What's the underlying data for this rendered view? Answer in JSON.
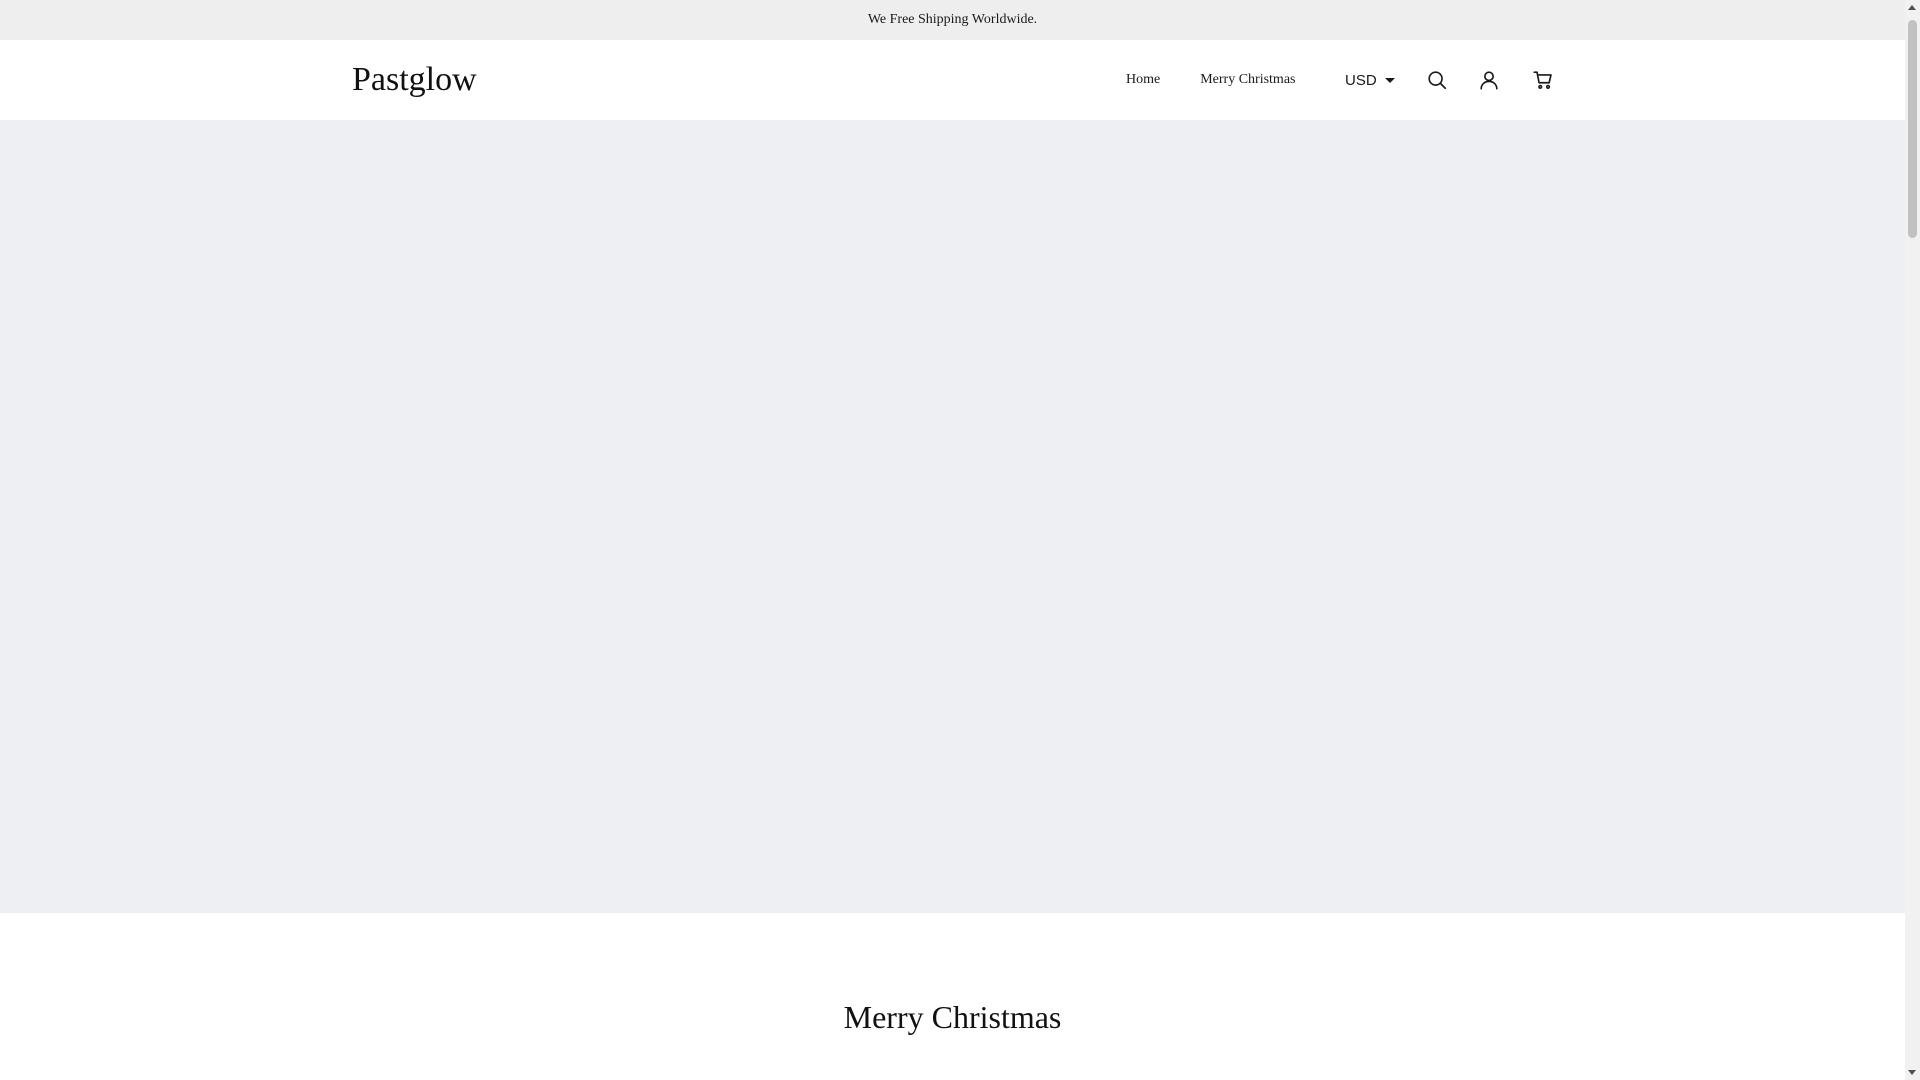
{
  "announcement": {
    "text": "We Free Shipping Worldwide."
  },
  "header": {
    "logo": "Pastglow",
    "nav": [
      {
        "label": "Home"
      },
      {
        "label": "Merry Christmas"
      }
    ],
    "currency": "USD",
    "icons": [
      "search-icon",
      "account-icon",
      "cart-icon"
    ]
  },
  "hero": {
    "background_color": "#eeeff3"
  },
  "section": {
    "title": "Merry Christmas"
  },
  "colors": {
    "announcement_bg": "#eeeeee",
    "text": "#1a1a1a"
  }
}
